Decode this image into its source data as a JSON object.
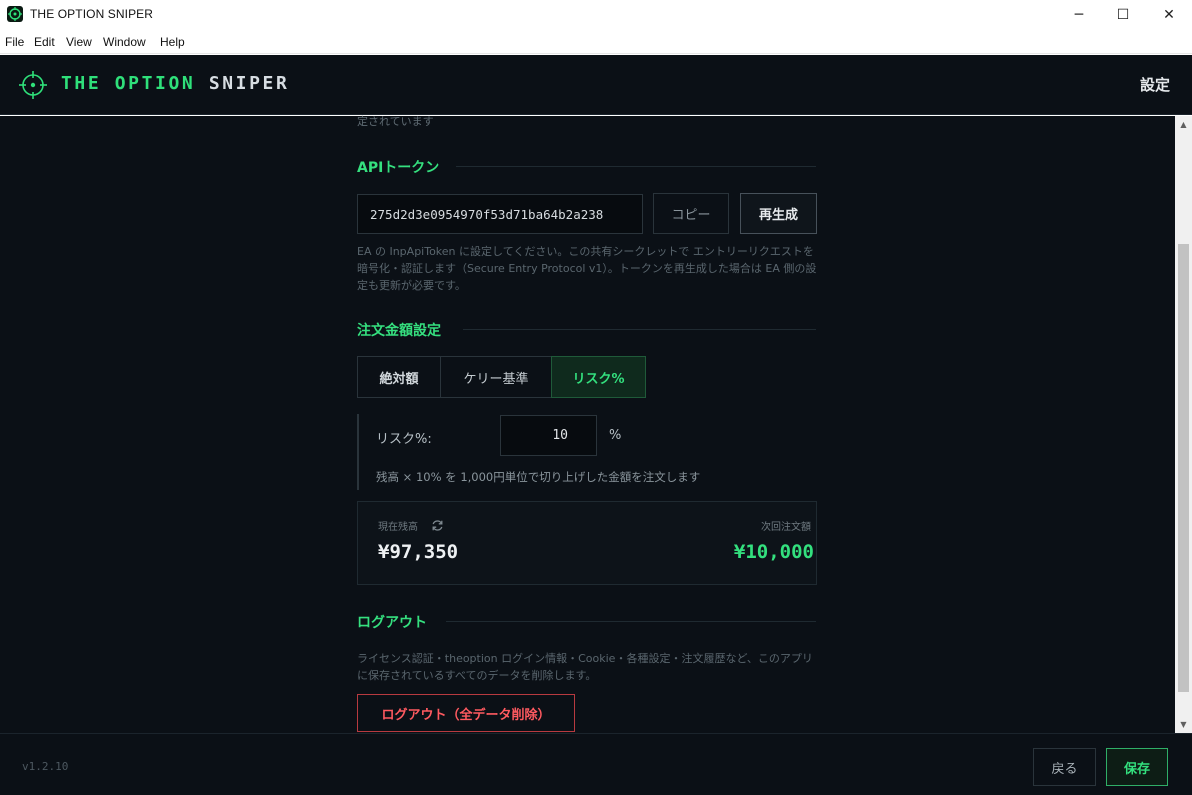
{
  "window": {
    "title": "THE OPTION SNIPER",
    "minimize_glyph": "─",
    "maximize_glyph": "☐",
    "close_glyph": "✕"
  },
  "menu": {
    "items": [
      "File",
      "Edit",
      "View",
      "Window",
      "Help"
    ]
  },
  "header": {
    "brand_part1": "THE OPTION",
    "brand_part2": "SNIPER",
    "settings_label": "設定",
    "accent_color": "#2fe07a"
  },
  "content": {
    "truncated_text": "定されています",
    "api_section": {
      "title": "APIトークン",
      "token_value": "275d2d3e0954970f53d71ba64b2a238",
      "copy_label": "コピー",
      "regen_label": "再生成",
      "description": "EA の InpApiToken に設定してください。この共有シークレットで エントリーリクエストを暗号化・認証します（Secure Entry Protocol v1）。トークンを再生成した場合は EA 側の設定も更新が必要です。"
    },
    "order_section": {
      "title": "注文金額設定",
      "tabs": [
        {
          "label": "絶対額",
          "selected": false
        },
        {
          "label": "ケリー基準",
          "selected": false
        },
        {
          "label": "リスク%",
          "selected": true
        }
      ],
      "risk_label": "リスク%:",
      "risk_value": "10",
      "risk_unit": "%",
      "risk_note": "残高 × 10% を 1,000円単位で切り上げした金額を注文します",
      "balance_label": "現在残高",
      "balance_value": "¥97,350",
      "next_order_label": "次回注文額",
      "next_order_value": "¥10,000"
    },
    "logout_section": {
      "title": "ログアウト",
      "description": "ライセンス認証・theoption ログイン情報・Cookie・各種設定・注文履歴など、このアプリに保存されているすべてのデータを削除します。",
      "button_label": "ログアウト（全データ削除）",
      "danger_color": "#ff5a60"
    }
  },
  "footer": {
    "version": "v1.2.10",
    "back_label": "戻る",
    "save_label": "保存"
  }
}
